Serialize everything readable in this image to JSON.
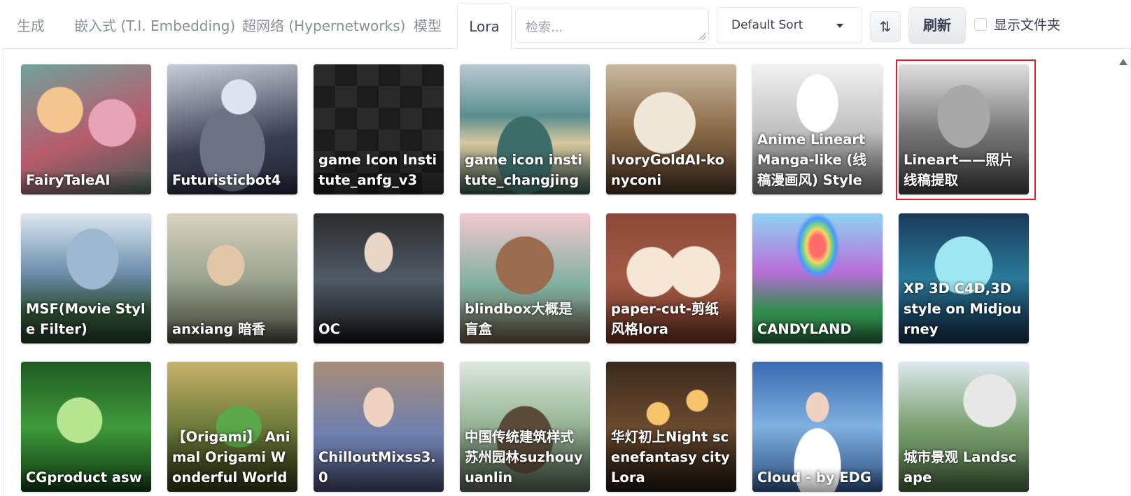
{
  "tabs": [
    {
      "label": "生成"
    },
    {
      "label": "嵌入式 (T.I. Embedding)"
    },
    {
      "label": "超网络 (Hypernetworks)"
    },
    {
      "label": "模型"
    },
    {
      "label": "Lora"
    }
  ],
  "search": {
    "placeholder": "检索..."
  },
  "sort": {
    "selected": "Default Sort",
    "direction_icon": "⇅"
  },
  "refresh": {
    "label": "刷新"
  },
  "show_folders": {
    "label": "显示文件夹",
    "checked": false
  },
  "selected_card": "Lineart——照片线稿提取",
  "cards": [
    {
      "title": "FairyTaleAI"
    },
    {
      "title": "Futuristicbot4"
    },
    {
      "title": "game Icon Institute_anfg_v3"
    },
    {
      "title": "game icon institute_changjing"
    },
    {
      "title": "IvoryGoldAI-konyconi"
    },
    {
      "title": "Anime Lineart Manga-like (线稿漫画风) Style"
    },
    {
      "title": "Lineart——照片线稿提取"
    },
    {
      "title": "MSF(Movie Style Filter)"
    },
    {
      "title": "anxiang 暗香"
    },
    {
      "title": "OC"
    },
    {
      "title": "blindbox大概是盲盒"
    },
    {
      "title": "paper-cut-剪纸风格lora"
    },
    {
      "title": "CANDYLAND"
    },
    {
      "title": "XP 3D C4D,3D style on Midjourney"
    },
    {
      "title": "CGproduct asw"
    },
    {
      "title": "【Origami】 Animal Origami Wonderful World"
    },
    {
      "title": "ChilloutMixss3.0"
    },
    {
      "title": "中国传统建筑样式苏州园林suzhouyuanlin"
    },
    {
      "title": "华灯初上Night scenefantasy city Lora"
    },
    {
      "title": "Cloud - by EDG"
    },
    {
      "title": "城市景观 Landscape"
    }
  ]
}
